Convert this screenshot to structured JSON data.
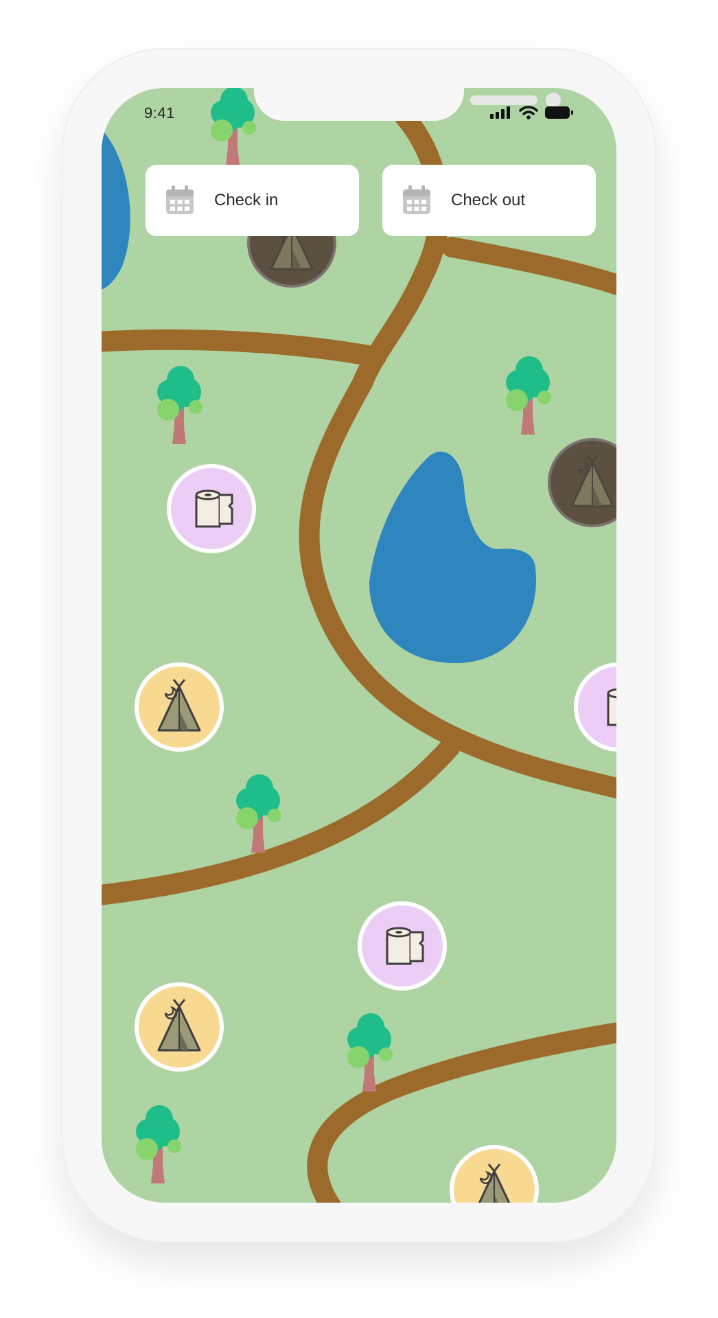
{
  "status_bar": {
    "time": "9:41"
  },
  "date_inputs": {
    "check_in_label": "Check in",
    "check_out_label": "Check out"
  },
  "map": {
    "colors": {
      "grass": "#afd4a3",
      "path": "#9c6b2b",
      "water": "#2f86bf",
      "tent_marker": "#f7d992",
      "tent_marker_booked": "#5c5040",
      "restroom_marker": "#ebcdf6",
      "tree_foliage": "#1fbd8a",
      "tree_trunk": "#c07878"
    },
    "markers": [
      {
        "name": "tent-marker",
        "icon": "tent-icon",
        "state": "booked"
      },
      {
        "name": "tent-marker",
        "icon": "tent-icon",
        "state": "booked"
      },
      {
        "name": "restroom-marker",
        "icon": "toilet-paper-icon",
        "state": "available"
      },
      {
        "name": "tent-marker",
        "icon": "tent-icon",
        "state": "available"
      },
      {
        "name": "restroom-marker",
        "icon": "toilet-paper-icon",
        "state": "available"
      },
      {
        "name": "restroom-marker",
        "icon": "toilet-paper-icon",
        "state": "available"
      },
      {
        "name": "tent-marker",
        "icon": "tent-icon",
        "state": "available"
      },
      {
        "name": "tent-marker",
        "icon": "tent-icon",
        "state": "available"
      }
    ]
  },
  "icons": {
    "calendar": "calendar-icon",
    "signal": "signal-icon",
    "wifi": "wifi-icon",
    "battery": "battery-icon"
  }
}
